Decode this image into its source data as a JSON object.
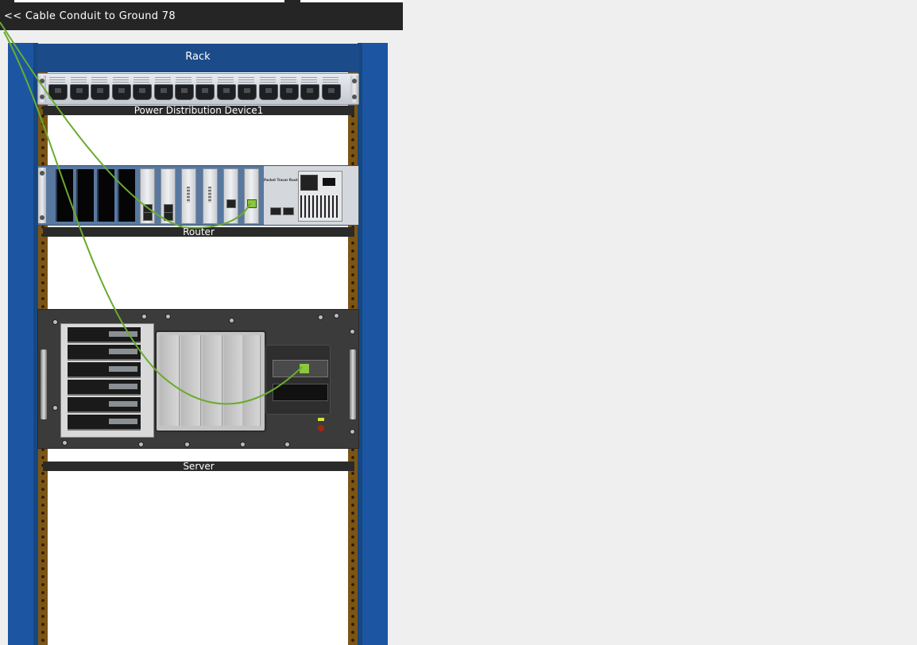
{
  "toolbar": {
    "back_link": "<< Cable Conduit to Ground 78"
  },
  "rack": {
    "title": "Rack",
    "devices": [
      {
        "name": "Power Distribution Device1"
      },
      {
        "name": "Router"
      },
      {
        "name": "Server"
      }
    ]
  },
  "router": {
    "model_text": "Packet Tracer Router"
  },
  "colors": {
    "post_blue": "#1c56a3",
    "header_blue": "#1b4b88",
    "rail_brown": "#7c5515",
    "cable_green": "#6aab2e",
    "toolbar_dark": "#252525"
  }
}
